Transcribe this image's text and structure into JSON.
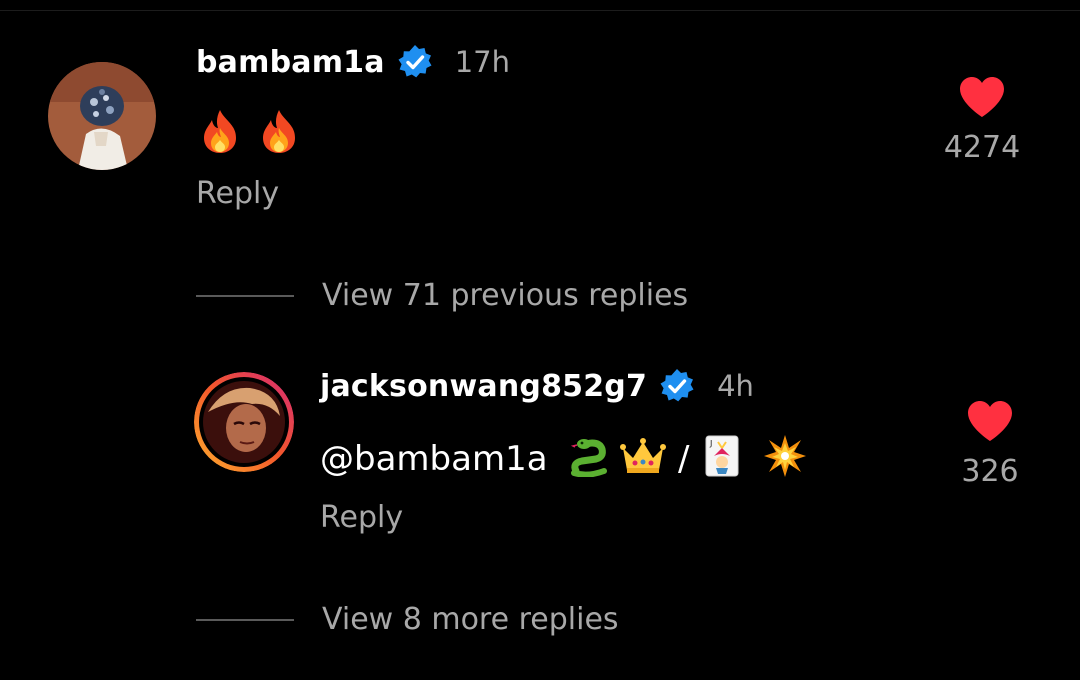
{
  "comments": [
    {
      "username": "bambam1a",
      "verified": true,
      "time": "17h",
      "text": "",
      "emojis": [
        "fire-icon",
        "fire-icon"
      ],
      "reply_label": "Reply",
      "likes": "4274"
    },
    {
      "username": "jacksonwang852g7",
      "verified": true,
      "time": "4h",
      "text": "@bambam1a",
      "emojis": [
        "snake-icon",
        "crown-icon",
        "slash",
        "joker-card-icon",
        "collision-icon"
      ],
      "slash_text": "/",
      "reply_label": "Reply",
      "likes": "326"
    }
  ],
  "thread": {
    "view_previous": "View 71 previous replies",
    "view_more": "View 8 more replies"
  },
  "colors": {
    "background": "#000000",
    "text_primary": "#ffffff",
    "text_secondary": "#a8a8a8",
    "verified_blue": "#1f8ff0",
    "heart_red": "#ff3040",
    "story_ring_start": "#ffb02e",
    "story_ring_end": "#d62976"
  }
}
